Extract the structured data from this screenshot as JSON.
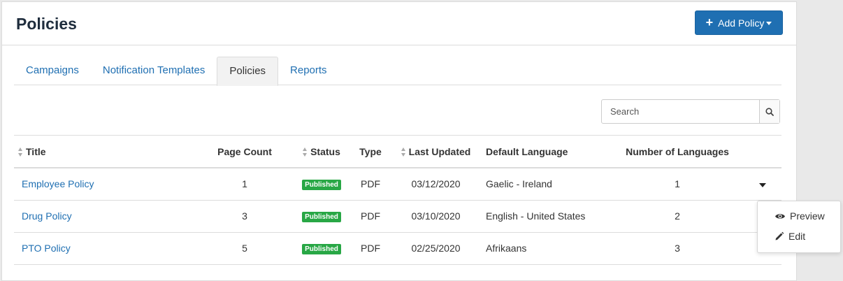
{
  "header": {
    "title": "Policies",
    "add_button_label": "Add Policy"
  },
  "tabs": [
    {
      "label": "Campaigns",
      "active": false
    },
    {
      "label": "Notification Templates",
      "active": false
    },
    {
      "label": "Policies",
      "active": true
    },
    {
      "label": "Reports",
      "active": false
    }
  ],
  "search": {
    "placeholder": "Search",
    "value": ""
  },
  "table": {
    "columns": {
      "title": "Title",
      "page_count": "Page Count",
      "status": "Status",
      "type": "Type",
      "last_updated": "Last Updated",
      "default_language": "Default Language",
      "number_of_languages": "Number of Languages"
    },
    "rows": [
      {
        "title": "Employee Policy",
        "page_count": "1",
        "status": "Published",
        "type": "PDF",
        "last_updated": "03/12/2020",
        "default_language": "Gaelic - Ireland",
        "number_of_languages": "1"
      },
      {
        "title": "Drug Policy",
        "page_count": "3",
        "status": "Published",
        "type": "PDF",
        "last_updated": "03/10/2020",
        "default_language": "English - United States",
        "number_of_languages": "2"
      },
      {
        "title": "PTO Policy",
        "page_count": "5",
        "status": "Published",
        "type": "PDF",
        "last_updated": "02/25/2020",
        "default_language": "Afrikaans",
        "number_of_languages": "3"
      }
    ]
  },
  "row_menu": {
    "preview_label": "Preview",
    "edit_label": "Edit"
  },
  "colors": {
    "primary": "#1f6fb2",
    "published_badge": "#28a745"
  }
}
